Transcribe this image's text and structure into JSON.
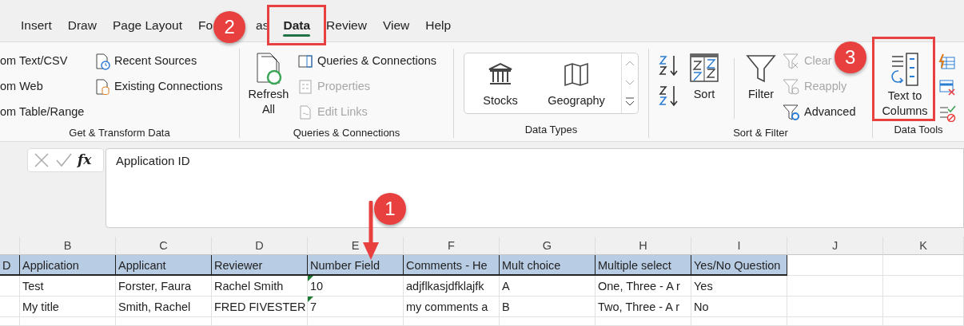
{
  "tabs": [
    {
      "label": "Insert",
      "selected": false
    },
    {
      "label": "Draw",
      "selected": false
    },
    {
      "label": "Page Layout",
      "selected": false
    },
    {
      "label": "Fo",
      "selected": false
    },
    {
      "label": "as",
      "kind": "fragment"
    },
    {
      "label": "Data",
      "selected": true
    },
    {
      "label": "Review",
      "selected": false
    },
    {
      "label": "View",
      "selected": false
    },
    {
      "label": "Help",
      "selected": false
    }
  ],
  "ribbon": {
    "groups": [
      {
        "label": "Get & Transform Data",
        "items": [
          {
            "label": "om Text/CSV"
          },
          {
            "label": "om Web"
          },
          {
            "label": "om Table/Range"
          },
          {
            "label": "Recent Sources"
          },
          {
            "label": "Existing Connections"
          }
        ]
      },
      {
        "label": "Queries & Connections",
        "refresh": "Refresh All",
        "items": [
          {
            "label": "Queries & Connections",
            "disabled": false
          },
          {
            "label": "Properties",
            "disabled": true
          },
          {
            "label": "Edit Links",
            "disabled": true
          }
        ]
      },
      {
        "label": "Data Types",
        "items": [
          {
            "label": "Stocks"
          },
          {
            "label": "Geography"
          }
        ]
      },
      {
        "label": "Sort & Filter",
        "sort": "Sort",
        "filter": "Filter",
        "items": [
          {
            "label": "Clear",
            "disabled": true
          },
          {
            "label": "Reapply",
            "disabled": true
          },
          {
            "label": "Advanced",
            "disabled": false
          }
        ]
      },
      {
        "label": "Data Tools",
        "text_to_columns": "Text to Columns"
      }
    ]
  },
  "formula_bar": {
    "fx": "fx",
    "content": "Application ID"
  },
  "sheet": {
    "columns": [
      "B",
      "C",
      "D",
      "E",
      "F",
      "G",
      "H",
      "I",
      "J",
      "K"
    ],
    "header_row": [
      "D",
      "Application",
      "Applicant",
      "Reviewer",
      "Number Field",
      "Comments - He",
      "Mult choice",
      "Multiple select",
      "Yes/No Question"
    ],
    "rows": [
      {
        "cells": [
          {
            "text": "Test",
            "flagged": false
          },
          {
            "text": "Forster, Faura",
            "flagged": false
          },
          {
            "text": "Rachel Smith",
            "flagged": false
          },
          {
            "text": "10",
            "flagged": true
          },
          {
            "text": "adjflkasjdfklajfk",
            "flagged": false
          },
          {
            "text": "A",
            "flagged": false
          },
          {
            "text": "One, Three - A r",
            "flagged": false
          },
          {
            "text": "Yes",
            "flagged": false
          }
        ]
      },
      {
        "cells": [
          {
            "text": "My title",
            "flagged": false
          },
          {
            "text": "Smith, Rachel",
            "flagged": false
          },
          {
            "text": "FRED FIVESTER",
            "flagged": false
          },
          {
            "text": "7",
            "flagged": true
          },
          {
            "text": "my comments a",
            "flagged": false
          },
          {
            "text": "B",
            "flagged": false
          },
          {
            "text": "Two, Three - A r",
            "flagged": false
          },
          {
            "text": "No",
            "flagged": false
          }
        ]
      }
    ]
  },
  "annotations": [
    {
      "label": "2"
    },
    {
      "label": "3"
    },
    {
      "label": "1"
    }
  ]
}
